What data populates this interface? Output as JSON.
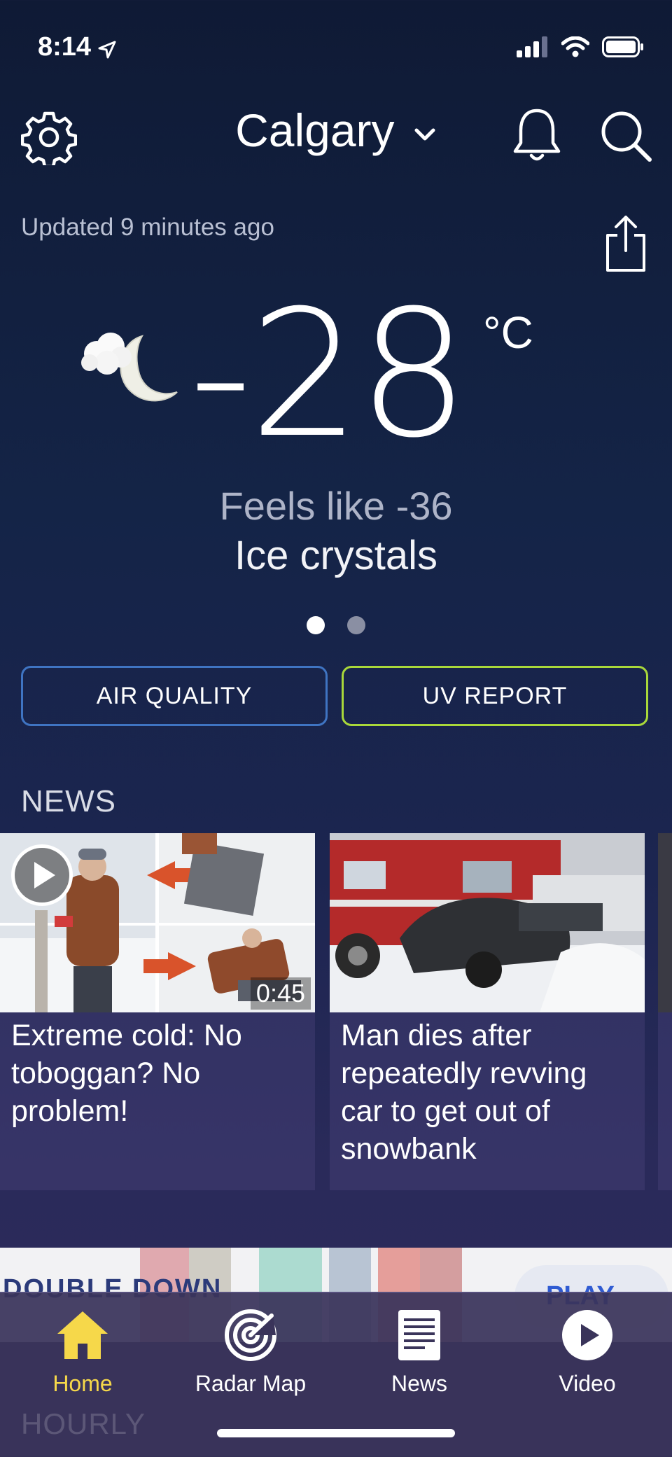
{
  "status_bar": {
    "time": "8:14"
  },
  "header": {
    "city": "Calgary"
  },
  "updated": "Updated 9 minutes ago",
  "current": {
    "temperature": "-28",
    "unit": "°C",
    "feels_like": "Feels like -36",
    "condition": "Ice crystals",
    "page_index": 1,
    "page_count": 2
  },
  "buttons": {
    "air_quality": "AIR QUALITY",
    "uv_report": "UV REPORT"
  },
  "news": {
    "section_title": "NEWS",
    "items": [
      {
        "title": "Extreme cold: No toboggan? No problem!",
        "duration": "0:45"
      },
      {
        "title": "Man dies after repeatedly revving car to get out of snowbank"
      }
    ]
  },
  "ad": {
    "brand": "DOUBLE DOWN",
    "cta": "PLAY"
  },
  "tabs": [
    {
      "label": "Home",
      "icon": "home-icon",
      "active": true
    },
    {
      "label": "Radar Map",
      "icon": "radar-icon"
    },
    {
      "label": "News",
      "icon": "news-icon"
    },
    {
      "label": "Video",
      "icon": "video-icon"
    }
  ],
  "hourly_title": "HOURLY",
  "colors": {
    "accent_active_tab": "#f6d84a",
    "air_quality_border": "#3f74c2",
    "uv_border": "#a9d83a"
  }
}
